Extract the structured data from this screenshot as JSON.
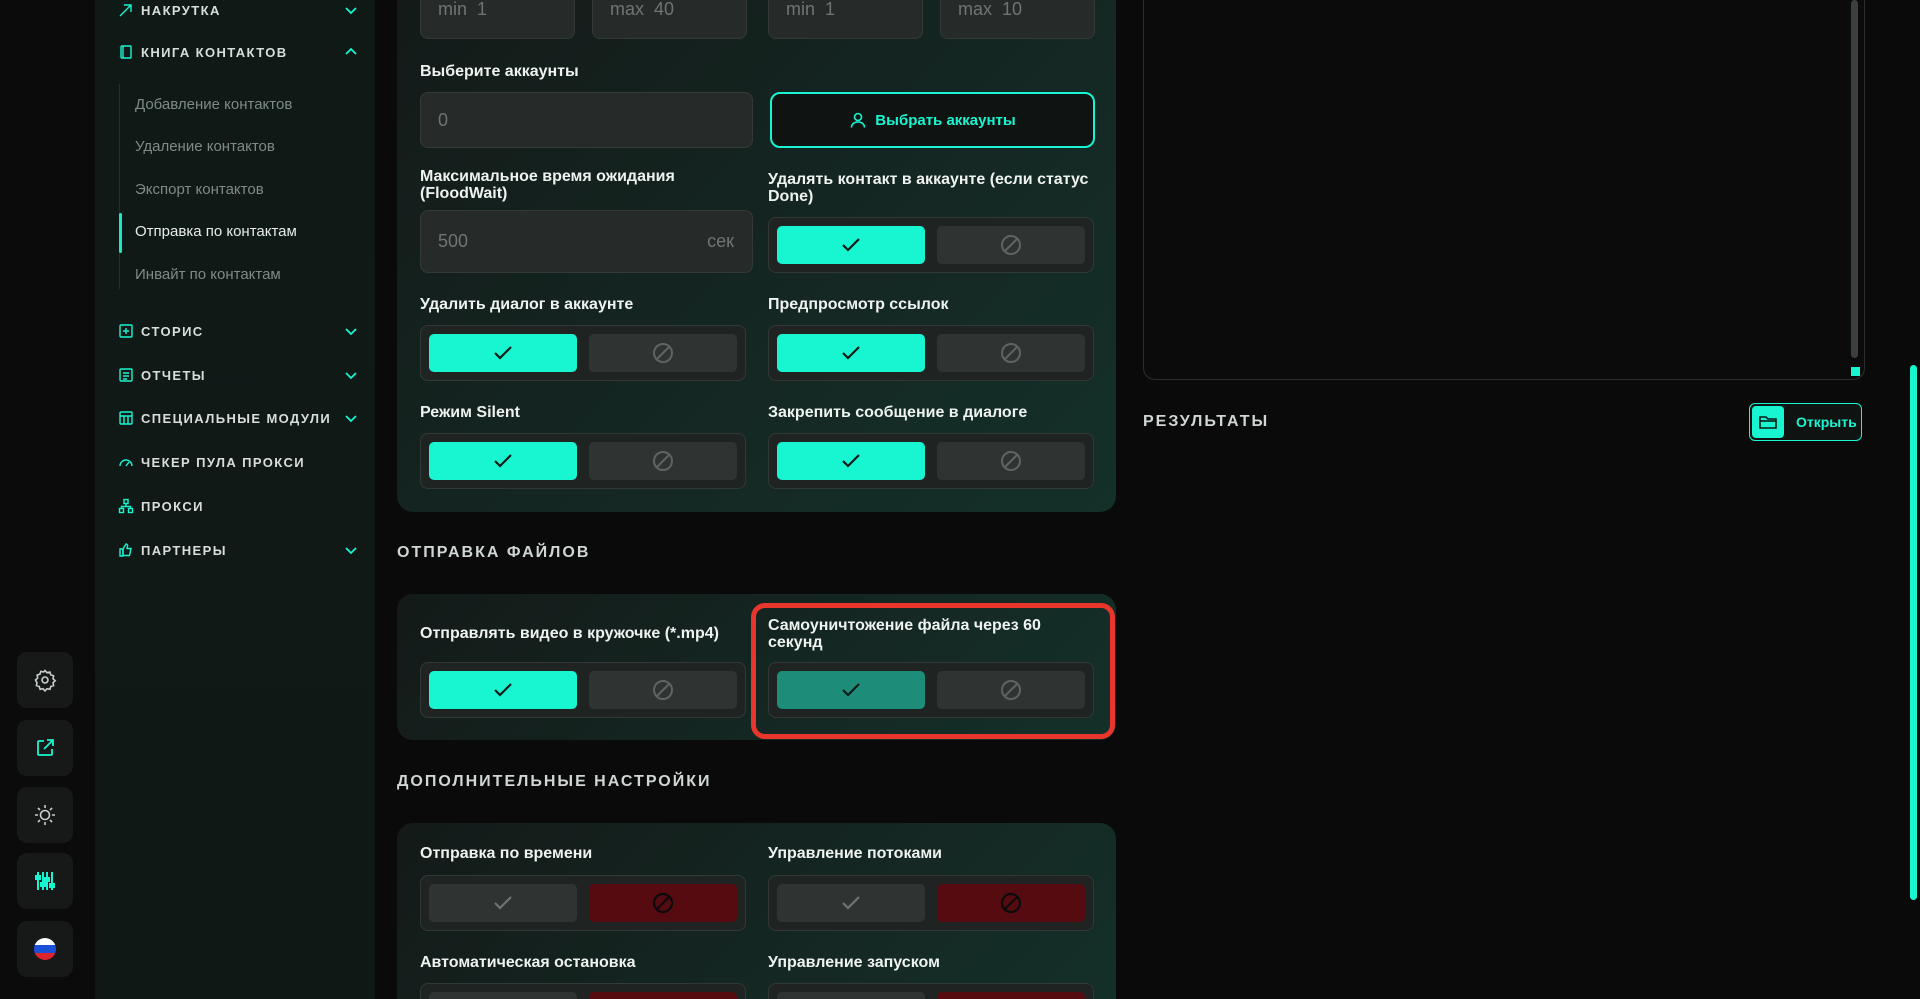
{
  "sidebar": {
    "groups": {
      "nakrutka": "НАКРУТКА",
      "contacts": "КНИГА КОНТАКТОВ",
      "stories": "СТОРИС",
      "reports": "ОТЧЕТЫ",
      "special": "СПЕЦИАЛЬНЫЕ МОДУЛИ",
      "proxy_checker": "ЧЕКЕР ПУЛА ПРОКСИ",
      "proxy": "ПРОКСИ",
      "partners": "ПАРТНЕРЫ"
    },
    "contacts_items": [
      "Добавление контактов",
      "Удаление контактов",
      "Экспорт контактов",
      "Отправка по контактам",
      "Инвайт по контактам"
    ],
    "active_item": "Отправка по контактам"
  },
  "rail": {
    "buttons": [
      "gear-icon",
      "external-link-icon",
      "sun-icon",
      "sliders-icon",
      "ru-flag-icon"
    ]
  },
  "top_inputs": {
    "min1": "min",
    "min1_val": "1",
    "max1": "max",
    "max1_val": "40",
    "min2": "min",
    "min2_val": "1",
    "max2": "max",
    "max2_val": "10"
  },
  "accounts": {
    "label": "Выберите аккаунты",
    "value": "0",
    "button": "Выбрать аккаунты"
  },
  "floodwait": {
    "label": "Максимальное время ожидания (FloodWait)",
    "value": "500",
    "unit": "сек"
  },
  "toggles_main": {
    "delete_contact": "Удалять контакт в аккаунте (если статус Done)",
    "delete_dialog": "Удалить диалог в аккаунте",
    "link_preview": "Предпросмотр ссылок",
    "silent": "Режим Silent",
    "pin_message": "Закрепить сообщение в диалоге"
  },
  "files_section": {
    "title": "ОТПРАВКА ФАЙЛОВ",
    "video_circle": "Отправлять видео в кружочке (*.mp4)",
    "self_destruct": "Самоуничтожение файла через 60 секунд"
  },
  "extra_section": {
    "title": "ДОПОЛНИТЕЛЬНЫЕ НАСТРОЙКИ",
    "send_time": "Отправка по времени",
    "threads": "Управление потоками",
    "auto_stop": "Автоматическая остановка",
    "launch_control": "Управление запуском"
  },
  "results": {
    "title": "РЕЗУЛЬТАТЫ",
    "open_button": "Открыть"
  },
  "colors": {
    "accent": "#18f5d1",
    "highlight": "#e8362c",
    "danger": "#560b10"
  }
}
